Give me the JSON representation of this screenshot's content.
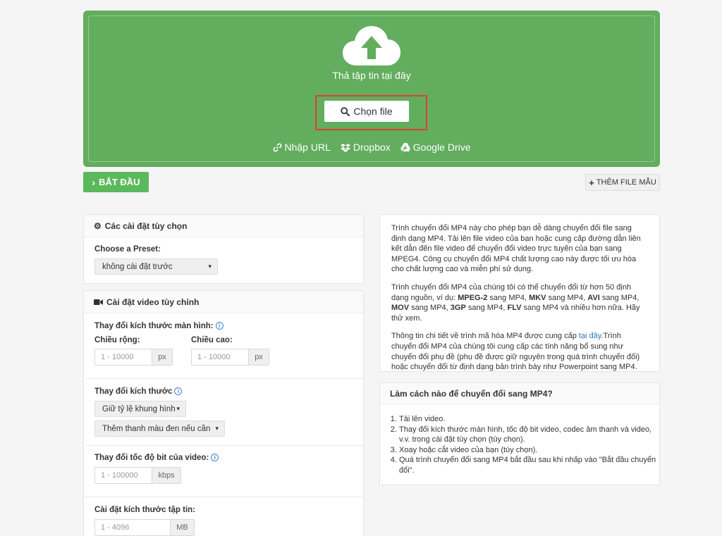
{
  "upload": {
    "drop_text": "Thả tập tin tại đây",
    "choose_label": "Chọn file",
    "sources": [
      {
        "icon": "link-icon",
        "label": "Nhập URL"
      },
      {
        "icon": "dropbox-icon",
        "label": "Dropbox"
      },
      {
        "icon": "google-drive-icon",
        "label": "Google Drive"
      }
    ]
  },
  "actions": {
    "start_label": "BẮT ĐẦU",
    "sample_label": "THÊM FILE MẪU"
  },
  "options_panel": {
    "title": "Các cài đặt tùy chọn",
    "preset_label": "Choose a Preset:",
    "preset_value": "không cài đặt trước"
  },
  "video_panel": {
    "title": "Cài đặt video tùy chỉnh",
    "screen_size_label": "Thay đổi kích thước màn hình:",
    "width_label": "Chiều rộng:",
    "height_label": "Chiều cao:",
    "width_placeholder": "1 - 10000",
    "height_placeholder": "1 - 10000",
    "px_unit": "px",
    "resize_label": "Thay đổi kích thước",
    "resize_select_1": "Giữ tỷ lệ khung hình",
    "resize_select_2": "Thêm thanh màu đen nếu cần",
    "bitrate_label": "Thay đổi tốc độ bit của video:",
    "bitrate_placeholder": "1 - 100000",
    "bitrate_unit": "kbps",
    "filesize_label": "Cài đặt kích thước tập tin:",
    "filesize_placeholder": "1 - 4096",
    "filesize_unit": "MB"
  },
  "description": {
    "p1": "Trình chuyển đổi MP4 này cho phép bạn dễ dàng chuyển đổi file sang định dạng MP4. Tải lên file video của bạn hoặc cung cấp đường dẫn liên kết dẫn đến file video để chuyển đổi video trực tuyến của bạn sang MPEG4. Công cụ chuyển đổi MP4 chất lượng cao này được tối ưu hóa cho chất lượng cao và miễn phí sử dụng.",
    "p2_a": "Trình chuyển đổi MP4 của chúng tôi có thể chuyển đổi từ hơn 50 định dạng nguồn, ví dụ: ",
    "p2_mpeg2": "MPEG-2",
    "p2_b": " sang MP4, ",
    "p2_mkv": "MKV",
    "p2_c": " sang MP4, ",
    "p2_avi": "AVI",
    "p2_d": " sang MP4, ",
    "p2_mov": "MOV",
    "p2_e": " sang MP4, ",
    "p2_3gp": "3GP",
    "p2_f": " sang MP4, ",
    "p2_flv": "FLV",
    "p2_g": " sang MP4 và nhiều hơn nữa. Hãy thử xem.",
    "p3_a": "Thông tin chi tiết về trình mã hóa MP4 được cung cấp ",
    "p3_link": "tại đây",
    "p3_b": ".Trình chuyển đổi MP4 của chúng tôi cung cấp các tính năng bổ sung như chuyển đổi phụ đề (phụ đề được giữ nguyên trong quá trình chuyển đổi) hoặc chuyển đổi từ định dạng bản trình bày như Powerpoint sang MP4."
  },
  "howto": {
    "title": "Làm cách nào để chuyển đổi sang MP4?",
    "steps": [
      "Tải lên video.",
      "Thay đổi kích thước màn hình, tốc độ bit video, codec âm thanh và video, v.v. trong cài đặt tùy chọn (tùy chọn).",
      "Xoay hoặc cắt video của bạn (tùy chọn).",
      "Quá trình chuyển đổi sang MP4 bắt đầu sau khi nhấp vào \"Bắt đầu chuyển đổi\"."
    ]
  },
  "colors": {
    "dropzone": "#62ad5e",
    "start": "#5cb85c",
    "highlight": "#d9442e",
    "link": "#2a7ac0"
  }
}
